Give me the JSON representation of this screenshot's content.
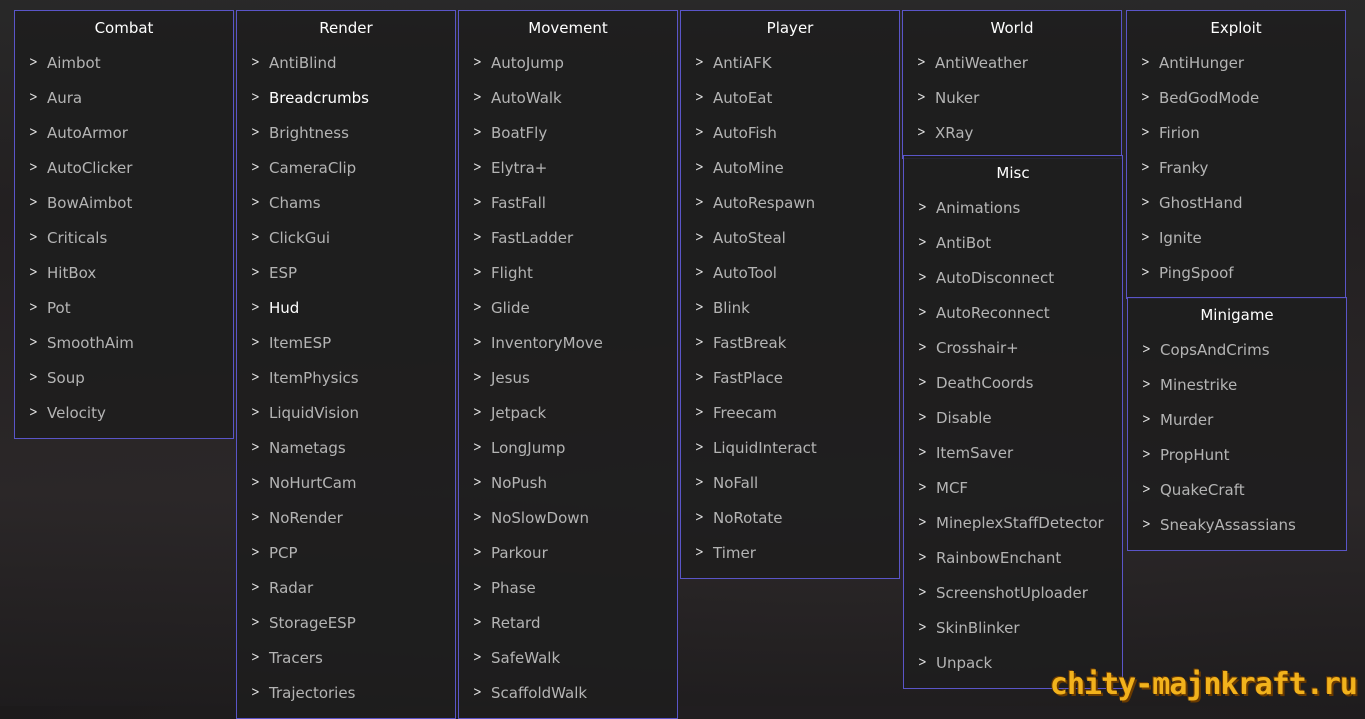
{
  "panels": [
    {
      "title": "Combat",
      "items": [
        "Aimbot",
        "Aura",
        "AutoArmor",
        "AutoClicker",
        "BowAimbot",
        "Criticals",
        "HitBox",
        "Pot",
        "SmoothAim",
        "Soup",
        "Velocity"
      ],
      "active": []
    },
    {
      "title": "Render",
      "items": [
        "AntiBlind",
        "Breadcrumbs",
        "Brightness",
        "CameraClip",
        "Chams",
        "ClickGui",
        "ESP",
        "Hud",
        "ItemESP",
        "ItemPhysics",
        "LiquidVision",
        "Nametags",
        "NoHurtCam",
        "NoRender",
        "PCP",
        "Radar",
        "StorageESP",
        "Tracers",
        "Trajectories"
      ],
      "active": [
        "Breadcrumbs",
        "Hud"
      ]
    },
    {
      "title": "Movement",
      "items": [
        "AutoJump",
        "AutoWalk",
        "BoatFly",
        "Elytra+",
        "FastFall",
        "FastLadder",
        "Flight",
        "Glide",
        "InventoryMove",
        "Jesus",
        "Jetpack",
        "LongJump",
        "NoPush",
        "NoSlowDown",
        "Parkour",
        "Phase",
        "Retard",
        "SafeWalk",
        "ScaffoldWalk"
      ],
      "active": []
    },
    {
      "title": "Player",
      "items": [
        "AntiAFK",
        "AutoEat",
        "AutoFish",
        "AutoMine",
        "AutoRespawn",
        "AutoSteal",
        "AutoTool",
        "Blink",
        "FastBreak",
        "FastPlace",
        "Freecam",
        "LiquidInteract",
        "NoFall",
        "NoRotate",
        "Timer"
      ],
      "active": []
    },
    {
      "title": "World",
      "items": [
        "AntiWeather",
        "Nuker",
        "XRay"
      ],
      "active": []
    },
    {
      "title": "Misc",
      "items": [
        "Animations",
        "AntiBot",
        "AutoDisconnect",
        "AutoReconnect",
        "Crosshair+",
        "DeathCoords",
        "Disable",
        "ItemSaver",
        "MCF",
        "MineplexStaffDetector",
        "RainbowEnchant",
        "ScreenshotUploader",
        "SkinBlinker",
        "Unpack"
      ],
      "active": []
    },
    {
      "title": "Exploit",
      "items": [
        "AntiHunger",
        "BedGodMode",
        "Firion",
        "Franky",
        "GhostHand",
        "Ignite",
        "PingSpoof"
      ],
      "active": []
    },
    {
      "title": "Minigame",
      "items": [
        "CopsAndCrims",
        "Minestrike",
        "Murder",
        "PropHunt",
        "QuakeCraft",
        "SneakyAssassians"
      ],
      "active": []
    }
  ],
  "watermark": "chity-majnkraft.ru",
  "colors": {
    "border": "#5a55c8",
    "watermark": "#f2b21c"
  }
}
